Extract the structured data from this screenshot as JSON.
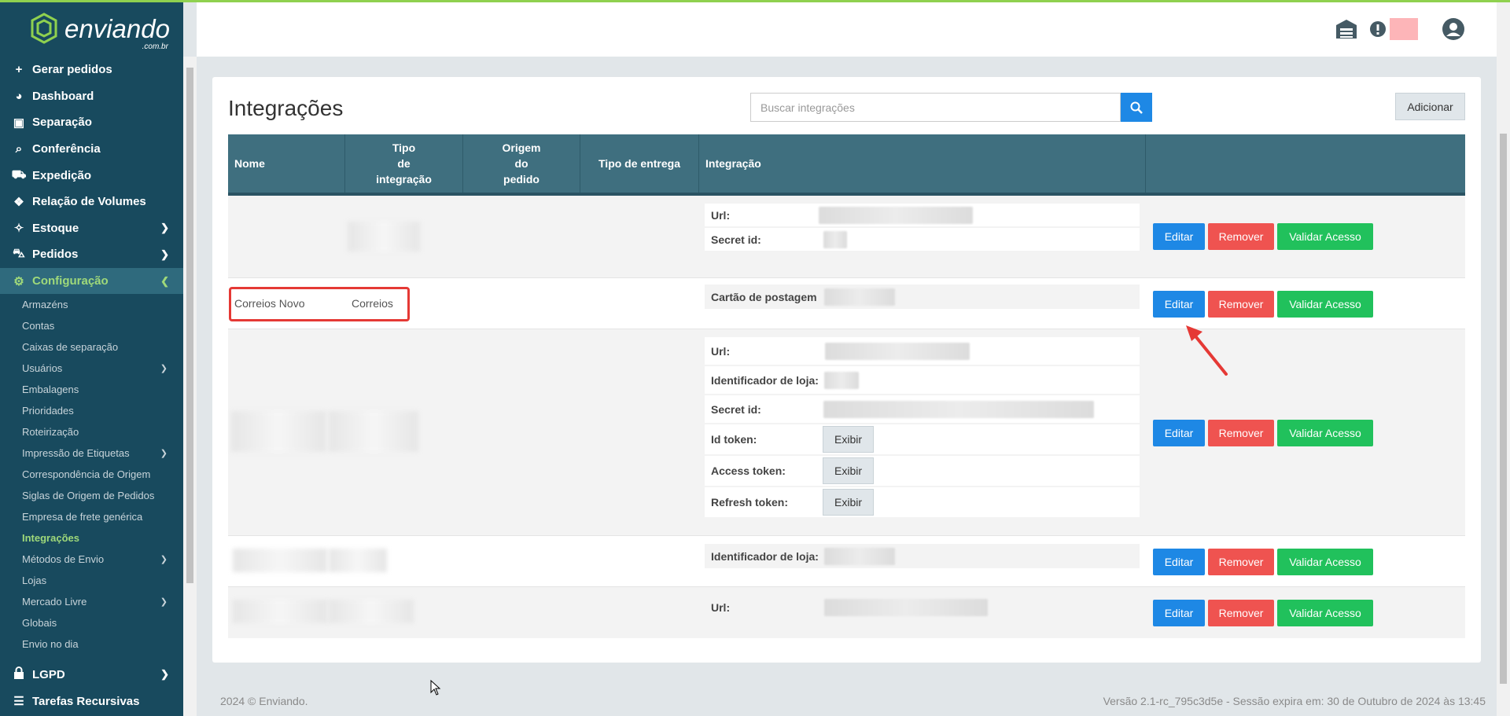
{
  "brand": {
    "name": "enviando",
    "sub": ".com.br"
  },
  "sidebar": {
    "items": [
      {
        "icon": "plus-icon",
        "glyph": "+",
        "label": "Gerar pedidos"
      },
      {
        "icon": "dashboard-icon",
        "glyph": "◕",
        "label": "Dashboard"
      },
      {
        "icon": "briefcase-icon",
        "glyph": "▣",
        "label": "Separação"
      },
      {
        "icon": "search-icon",
        "glyph": "⌕",
        "label": "Conferência"
      },
      {
        "icon": "truck-icon",
        "glyph": "⛟",
        "label": "Expedição"
      },
      {
        "icon": "boxes-icon",
        "glyph": "❖",
        "label": "Relação de Volumes"
      },
      {
        "icon": "dropbox-icon",
        "glyph": "✧",
        "label": "Estoque"
      },
      {
        "icon": "cart-icon",
        "glyph": "⛍",
        "label": "Pedidos"
      },
      {
        "icon": "gear-icon",
        "glyph": "⚙",
        "label": "Configuração"
      }
    ],
    "sub_items": [
      "Armazéns",
      "Contas",
      "Caixas de separação",
      "Usuários",
      "Embalagens",
      "Prioridades",
      "Roteirização",
      "Impressão de Etiquetas",
      "Correspondência de Origem",
      "Siglas de Origem de Pedidos",
      "Empresa de frete genérica",
      "Integrações",
      "Métodos de Envio",
      "Lojas",
      "Mercado Livre",
      "Globais",
      "Envio no dia"
    ],
    "bottom_items": [
      {
        "icon": "lock-icon",
        "glyph": "🔒",
        "label": "LGPD"
      },
      {
        "icon": "tasks-icon",
        "glyph": "☰",
        "label": "Tarefas Recursivas"
      }
    ]
  },
  "header": {
    "icons": [
      "warehouse-icon",
      "alert-icon",
      "user-icon"
    ]
  },
  "page": {
    "title": "Integrações",
    "search_placeholder": "Buscar integrações",
    "add_label": "Adicionar"
  },
  "table": {
    "headers": {
      "nome": "Nome",
      "tipo": [
        "Tipo",
        "de",
        "integração"
      ],
      "origem": [
        "Origem",
        "do",
        "pedido"
      ],
      "entrega": "Tipo de entrega",
      "integracao": "Integração"
    },
    "labels": {
      "url": "Url:",
      "secret": "Secret id:",
      "cartao": "Cartão de postagem",
      "loja": "Identificador de loja:",
      "id_token": "Id token:",
      "access_token": "Access token:",
      "refresh_token": "Refresh token:"
    },
    "correios_row": {
      "nome": "Correios Novo",
      "tipo": "Correios"
    },
    "buttons": {
      "exibir": "Exibir",
      "edit": "Editar",
      "remove": "Remover",
      "validate": "Validar Acesso"
    }
  },
  "footer": {
    "copyright": "2024 © Enviando.",
    "version": "Versão 2.1-rc_795c3d5e - Sessão expira em: 30 de Outubro de 2024 às 13:45"
  },
  "colors": {
    "sidebar": "#184a5e",
    "accent": "#8fd14f",
    "header_table": "#3f6f7f",
    "edit": "#1e88e5",
    "remove": "#ef5350",
    "validate": "#21c15c",
    "highlight": "#e53935"
  }
}
